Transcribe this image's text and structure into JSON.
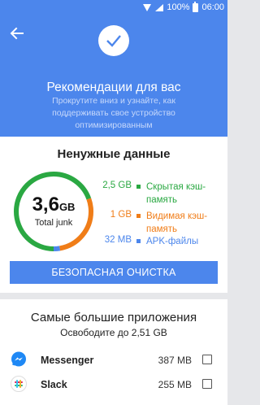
{
  "status_bar": {
    "battery": "100%",
    "time": "06:00",
    "icons": [
      "wifi-icon",
      "signal-icon",
      "battery-icon"
    ]
  },
  "header": {
    "back_icon": "arrow-left-icon",
    "check_icon": "check-icon",
    "title": "Рекомендации для вас",
    "subtitle": "Прокрутите вниз и узнайте, как поддерживать свое устройство оптимизированным"
  },
  "junk": {
    "title": "Ненужные данные",
    "total_value": "3,6",
    "total_unit": "GB",
    "total_label": "Total junk",
    "items": [
      {
        "value": "2,5 GB",
        "name": "Скрытая кэш-память",
        "color": "#2aa842",
        "value_color": "#2aa842",
        "fraction": 0.694
      },
      {
        "value": "1 GB",
        "name": "Видимая кэш-память",
        "color": "#f07d18",
        "value_color": "#f07d18",
        "fraction": 0.278
      },
      {
        "value": "32 MB",
        "name": "APK-файлы",
        "color": "#4c86ec",
        "value_color": "#4c86ec",
        "fraction": 0.028
      }
    ],
    "button_label": "БЕЗОПАСНАЯ ОЧИСТКА"
  },
  "apps": {
    "title": "Самые большие приложения",
    "subtitle": "Освободите до 2,51 GB",
    "items": [
      {
        "name": "Messenger",
        "size": "387 MB",
        "icon": "messenger-icon",
        "checked": false
      },
      {
        "name": "Slack",
        "size": "255 MB",
        "icon": "slack-icon",
        "checked": false
      }
    ]
  },
  "colors": {
    "accent": "#4c86ec",
    "green": "#2aa842",
    "orange": "#f07d18"
  }
}
